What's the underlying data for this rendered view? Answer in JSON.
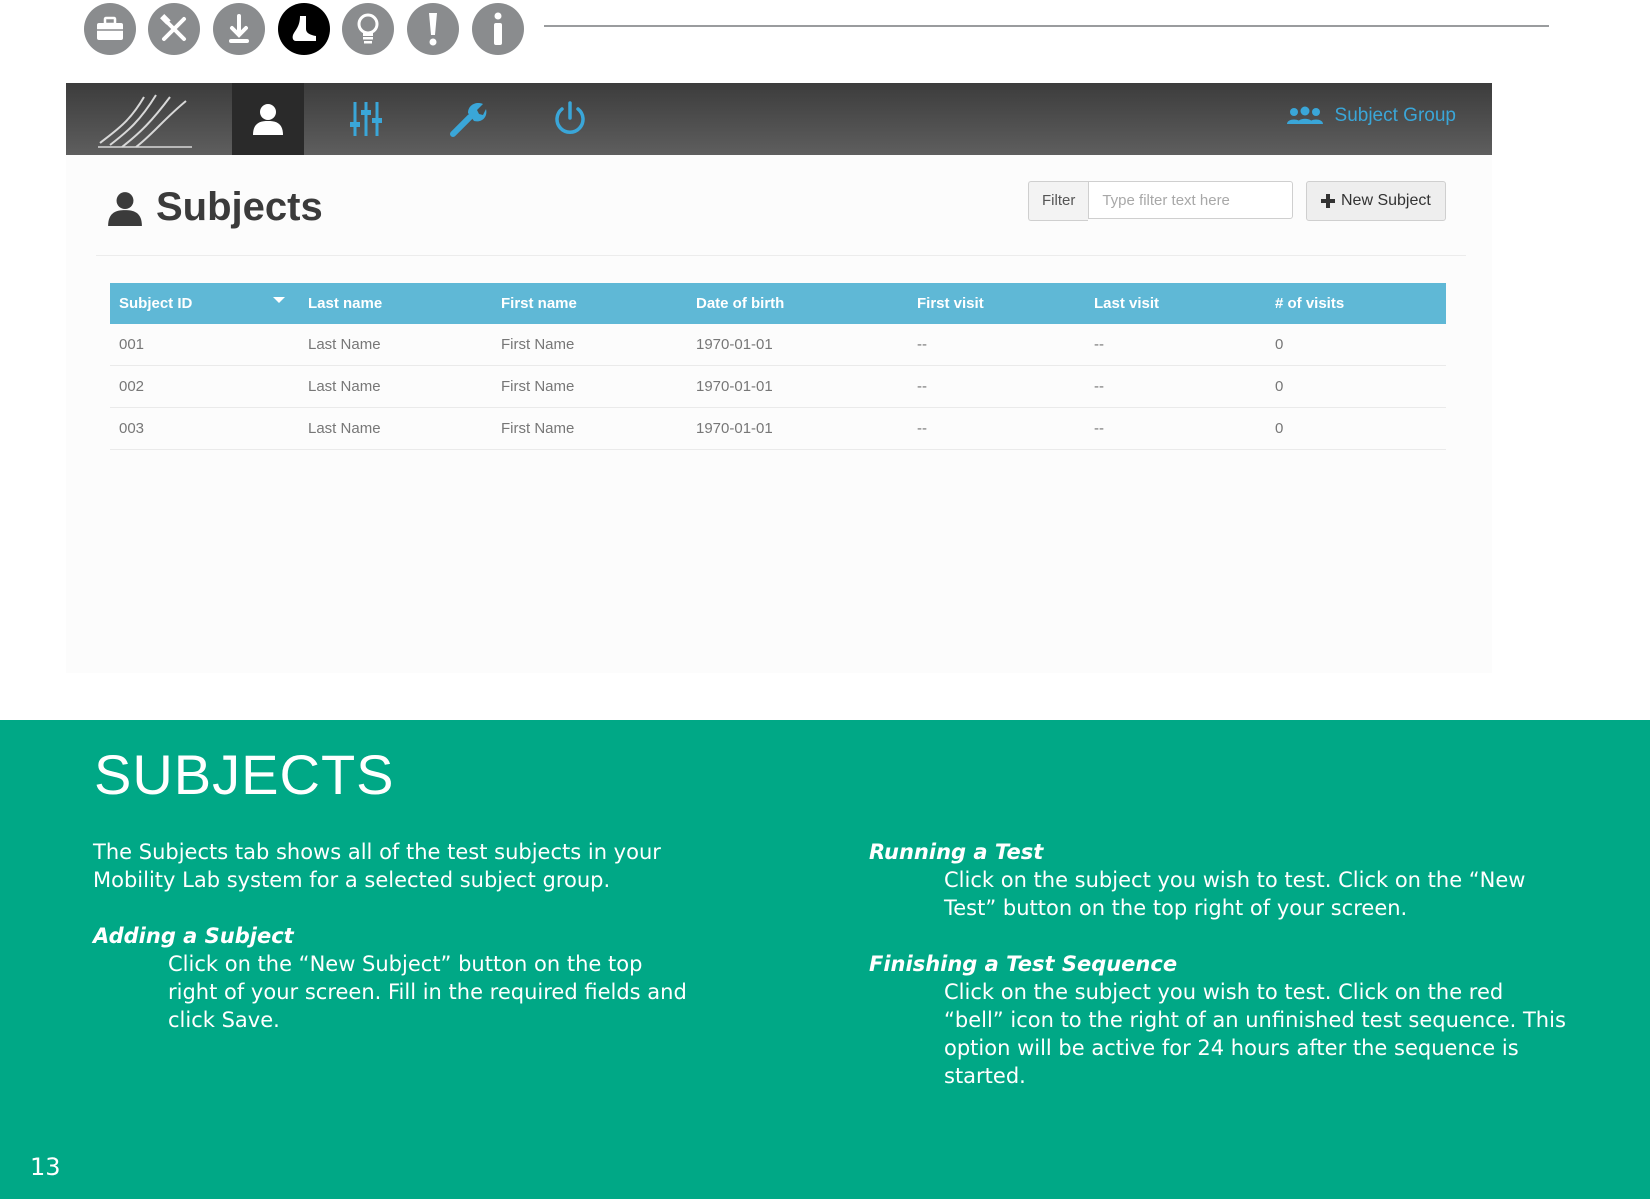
{
  "manual_nav": {
    "icons": [
      "briefcase-icon",
      "tools-icon",
      "download-icon",
      "foot-icon",
      "lightbulb-icon",
      "exclamation-icon",
      "info-icon"
    ],
    "active_icon": "foot-icon",
    "active_color": "#000000",
    "inactive_color": "#8a8c8e"
  },
  "app": {
    "tabs": [
      "subjects-tab",
      "settings-tab",
      "tools-tab",
      "power-tab"
    ],
    "selected_tab": "subjects-tab",
    "subject_group_label": "Subject Group",
    "accent_color": "#3aa6d8"
  },
  "subjects_page": {
    "title": "Subjects",
    "filter_label": "Filter",
    "filter_placeholder": "Type filter text here",
    "new_subject_label": "New Subject",
    "table": {
      "columns": [
        "Subject ID",
        "Last name",
        "First name",
        "Date of birth",
        "First visit",
        "Last visit",
        "# of visits"
      ],
      "sorted_column": "Subject ID",
      "header_color": "#5fb8d6",
      "rows": [
        [
          "001",
          "Last Name",
          "First Name",
          "1970-01-01",
          "--",
          "--",
          "0"
        ],
        [
          "002",
          "Last Name",
          "First Name",
          "1970-01-01",
          "--",
          "--",
          "0"
        ],
        [
          "003",
          "Last Name",
          "First Name",
          "1970-01-01",
          "--",
          "--",
          "0"
        ]
      ]
    }
  },
  "manual": {
    "section_title": "SUBJECTS",
    "panel_color": "#00a886",
    "intro": "The Subjects tab shows all of the test subjects in your Mobility Lab system for a selected subject group.",
    "adding": {
      "heading": "Adding a Subject",
      "body": "Click on the “New Subject” button on the top right of your screen. Fill in the required fields and click Save."
    },
    "running": {
      "heading": "Running a Test",
      "body": "Click on the subject you wish to test. Click on the “New Test” button on the top right of your screen."
    },
    "finishing": {
      "heading": "Finishing a Test Sequence",
      "body": "Click on the subject you wish to test. Click on the red “bell” icon to the right of an unfinished test sequence. This option will be active for 24 hours after the sequence is started."
    },
    "page_number": "13"
  }
}
